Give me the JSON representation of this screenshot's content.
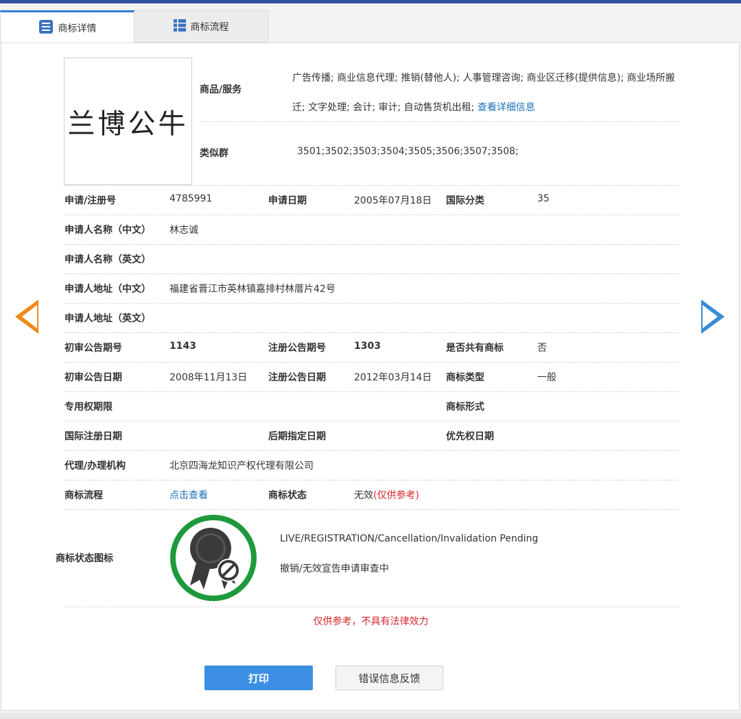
{
  "tabs": [
    {
      "label": "商标详情",
      "icon": "list-icon"
    },
    {
      "label": "商标流程",
      "icon": "grid-list-icon"
    }
  ],
  "logo_text": "兰博公牛",
  "goods": {
    "label": "商品/服务",
    "text": "广告传播; 商业信息代理; 推销(替他人); 人事管理咨询; 商业区迁移(提供信息); 商业场所搬迁; 文字处理; 会计; 审计; 自动售货机出租;",
    "link": "查看详细信息"
  },
  "similar_group": {
    "label": "类似群",
    "value": "3501;3502;3503;3504;3505;3506;3507;3508;"
  },
  "fields": {
    "reg_no_label": "申请/注册号",
    "reg_no": "4785991",
    "apply_date_label": "申请日期",
    "apply_date": "2005年07月18日",
    "intl_class_label": "国际分类",
    "intl_class": "35",
    "applicant_cn_label": "申请人名称（中文）",
    "applicant_cn": "林志诚",
    "applicant_en_label": "申请人名称（英文）",
    "applicant_en": "",
    "address_cn_label": "申请人地址（中文）",
    "address_cn": "福建省晋江市英林镇嘉排村林厝片42号",
    "address_en_label": "申请人地址（英文）",
    "address_en": "",
    "prelim_issue_label": "初审公告期号",
    "prelim_issue": "1143",
    "reg_issue_label": "注册公告期号",
    "reg_issue": "1303",
    "shared_label": "是否共有商标",
    "shared": "否",
    "prelim_date_label": "初审公告日期",
    "prelim_date": "2008年11月13日",
    "reg_date_label": "注册公告日期",
    "reg_date": "2012年03月14日",
    "tm_type_label": "商标类型",
    "tm_type": "一般",
    "exclusive_term_label": "专用权期限",
    "exclusive_term": "",
    "tm_form_label": "商标形式",
    "tm_form": "",
    "intl_reg_date_label": "国际注册日期",
    "intl_reg_date": "",
    "later_date_label": "后期指定日期",
    "later_date": "",
    "priority_date_label": "优先权日期",
    "priority_date": "",
    "agency_label": "代理/办理机构",
    "agency": "北京四海龙知识产权代理有限公司",
    "flow_label": "商标流程",
    "flow_link": "点击查看",
    "status_label": "商标状态",
    "status_value": "无效",
    "status_note": "(仅供参考)",
    "status_icon_label": "商标状态图标"
  },
  "status_icon": {
    "name": "award-ribbon-cancel-icon",
    "ring_color": "#1e9a3c",
    "line1": "LIVE/REGISTRATION/Cancellation/Invalidation Pending",
    "line2": "撤销/无效宣告申请审查中"
  },
  "disclaimer": "仅供参考，不具有法律效力",
  "buttons": {
    "print": "打印",
    "feedback": "错误信息反馈"
  },
  "nav": {
    "prev_icon": "arrow-left-icon",
    "next_icon": "arrow-right-icon"
  },
  "colors": {
    "accent": "#3d8fe3",
    "prev_arrow": "#f08a1c",
    "next_arrow": "#3a8cd6",
    "warning": "#d9272a",
    "link": "#1b6fb8"
  }
}
